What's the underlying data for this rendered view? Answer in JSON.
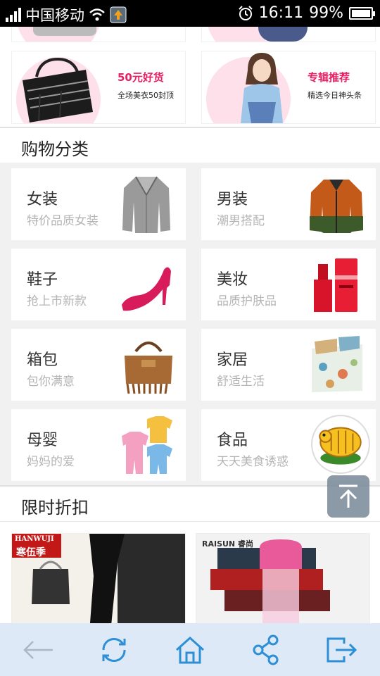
{
  "status_bar": {
    "carrier": "中国移动",
    "time": "16:11",
    "battery": "99%"
  },
  "banners": [
    {
      "title": "50元好货",
      "subtitle": "全场美衣50封顶"
    },
    {
      "title": "专辑推荐",
      "subtitle": "精选今日神头条"
    }
  ],
  "shopping_section": {
    "title": "购物分类"
  },
  "categories": [
    {
      "name": "女装",
      "desc": "特价品质女装"
    },
    {
      "name": "男装",
      "desc": "潮男搭配"
    },
    {
      "name": "鞋子",
      "desc": "抢上市新款"
    },
    {
      "name": "美妆",
      "desc": "品质护肤品"
    },
    {
      "name": "箱包",
      "desc": "包你满意"
    },
    {
      "name": "家居",
      "desc": "舒适生活"
    },
    {
      "name": "母婴",
      "desc": "妈妈的爱"
    },
    {
      "name": "食品",
      "desc": "天天美食诱惑"
    }
  ],
  "discount_section": {
    "title": "限时折扣"
  },
  "products": [
    {
      "brand": "HANWUJI",
      "brand_cn": "寒伍季"
    },
    {
      "brand": "RAISUN 睿尚"
    }
  ],
  "colors": {
    "accent_pink": "#e91e63",
    "toolbar_bg": "#dde9f6",
    "icon_blue": "#2d8fd5"
  },
  "toolbar_icons": [
    "back-arrow-icon",
    "refresh-icon",
    "home-icon",
    "share-icon",
    "exit-icon"
  ]
}
